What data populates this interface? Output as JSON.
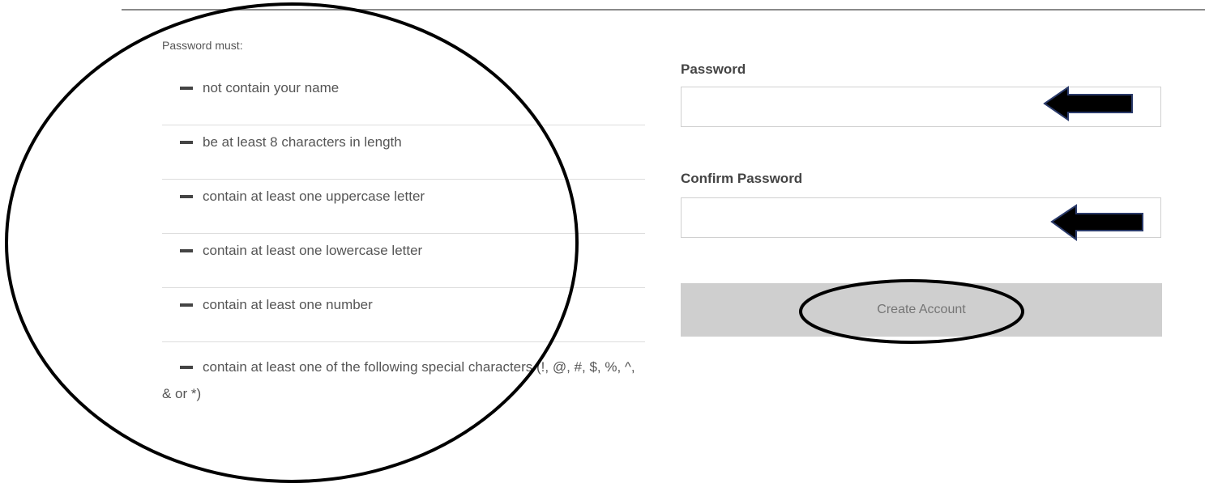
{
  "requirements": {
    "title": "Password must:",
    "items": [
      "not contain your name",
      "be at least 8 characters in length",
      "contain at least one uppercase letter",
      "contain at least one lowercase letter",
      "contain at least one number",
      "contain at least one of the following special characters (!, @, #, $, %, ^, & or *)"
    ]
  },
  "form": {
    "password_label": "Password",
    "password_value": "",
    "confirm_label": "Confirm Password",
    "confirm_value": "",
    "submit_label": "Create Account"
  },
  "annotations": {
    "stroke_color": "#000000",
    "arrow_fill": "#000000",
    "arrow_outline": "#2a3a6a"
  }
}
